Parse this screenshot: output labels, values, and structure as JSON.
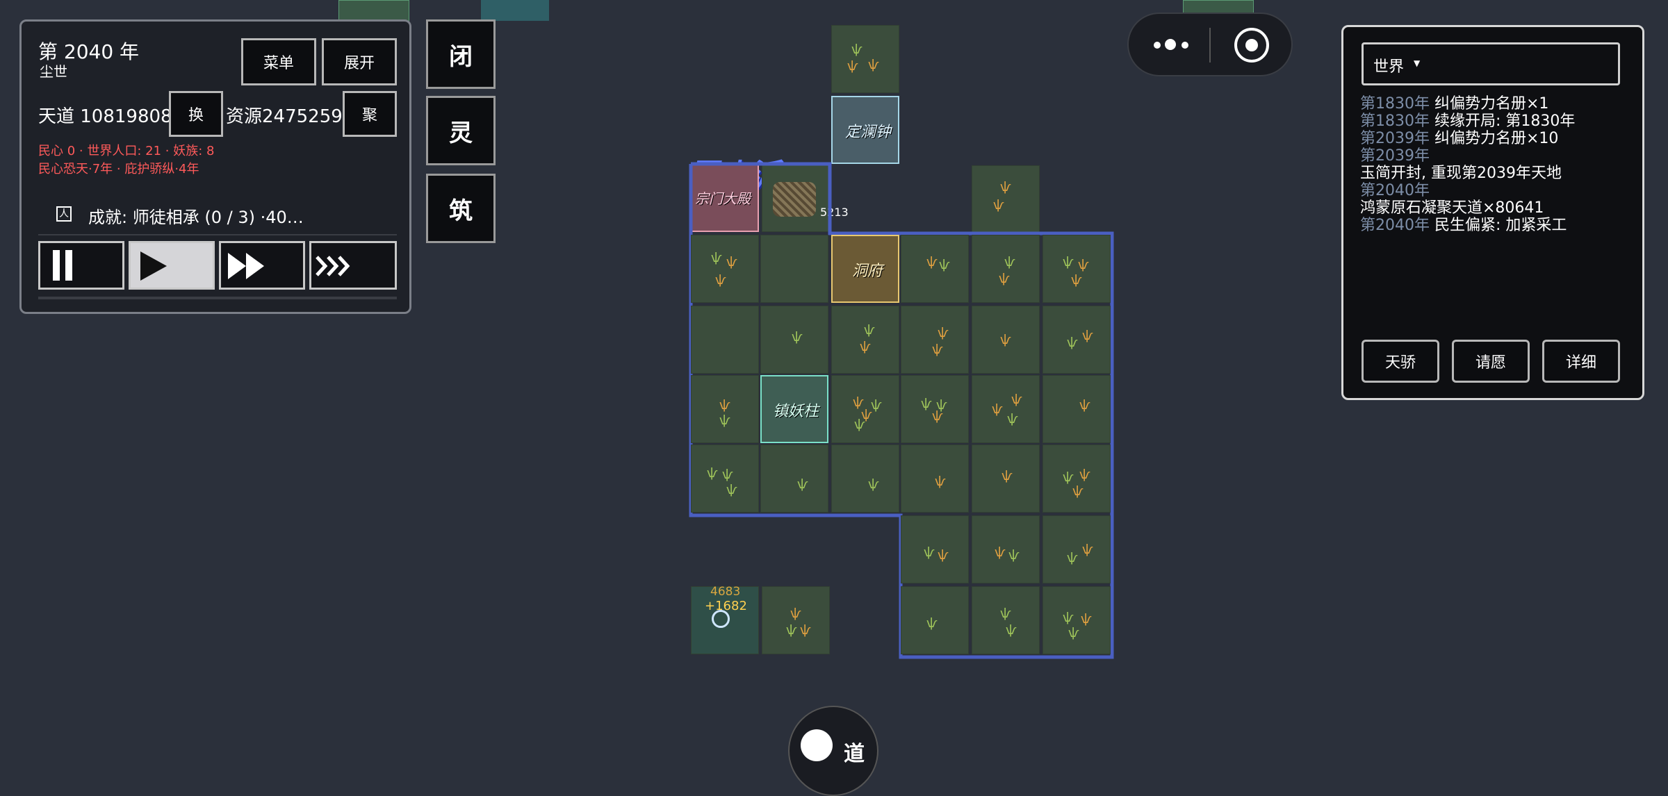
{
  "status": {
    "year_line": "第 2040 年",
    "era": "尘世",
    "menu_label": "菜单",
    "expand_label": "展开",
    "tiandao": "天道 10819808",
    "swap_label": "换",
    "resources": "资源2475259",
    "gather_label": "聚",
    "warn_line1": "民心 0 · 世界人口: 21 · 妖族: 8",
    "warn_line2": "民心恐天·7年 · 庇护骄纵·4年",
    "achievement": "成就: 师徒相承 (0 / 3) ·40…",
    "warn_color": "#ff5a5a"
  },
  "side_buttons": {
    "close": "闭",
    "spirit": "灵",
    "build": "筑"
  },
  "map": {
    "sect_name": "蜀山派",
    "labels": {
      "sect_hall": "宗门大殿",
      "bell": "定澜钟",
      "cave": "洞府",
      "pillar": "镇妖柱"
    },
    "hall_value": "5213",
    "float_value1": "4683",
    "float_value2": "+1682"
  },
  "bottom_button": "道",
  "log": {
    "filter_label": "世界",
    "entries": [
      {
        "year": "第1830年",
        "text": " 纠偏势力名册×1"
      },
      {
        "year": "第1830年",
        "text": " 续缘开局: 第1830年"
      },
      {
        "year": "第2039年",
        "text": " 纠偏势力名册×10"
      },
      {
        "year": "第2039年",
        "text": ""
      },
      {
        "year": "",
        "text": "玉简开封, 重现第2039年天地"
      },
      {
        "year": "第2040年",
        "text": ""
      },
      {
        "year": "",
        "text": "鸿蒙原石凝聚天道×80641"
      },
      {
        "year": "第2040年",
        "text": " 民生偏紧: 加紧采工"
      }
    ],
    "btn_genius": "天骄",
    "btn_wish": "请愿",
    "btn_detail": "详细"
  }
}
